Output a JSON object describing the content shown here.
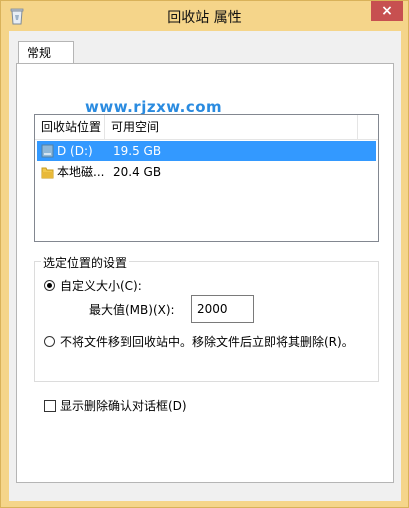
{
  "window": {
    "title": "回收站 属性",
    "close_label": "×",
    "icon": "recycle-bin-icon"
  },
  "tabs": [
    {
      "label": "常规",
      "selected": true
    }
  ],
  "watermark": "www.rjzxw.com",
  "listview": {
    "columns": [
      "回收站位置",
      "可用空间"
    ],
    "rows": [
      {
        "location": "D (D:)",
        "free_space": "19.5 GB",
        "selected": true,
        "icon": "drive-icon"
      },
      {
        "location": "本地磁...",
        "free_space": "20.4 GB",
        "selected": false,
        "icon": "folder-drive-icon"
      }
    ]
  },
  "settings": {
    "group_label": "选定位置的设置",
    "custom_size_label": "自定义大小(C):",
    "custom_size_selected": true,
    "max_size_label": "最大值(MB)(X):",
    "max_size_value": "2000",
    "no_move_label": "不将文件移到回收站中。移除文件后立即将其删除(R)。",
    "no_move_selected": false
  },
  "confirm": {
    "label": "显示删除确认对话框(D)",
    "checked": false
  },
  "colors": {
    "frame": "#f5d58a",
    "close": "#c75050",
    "selection": "#3399ff",
    "watermark": "#2a8be0"
  }
}
